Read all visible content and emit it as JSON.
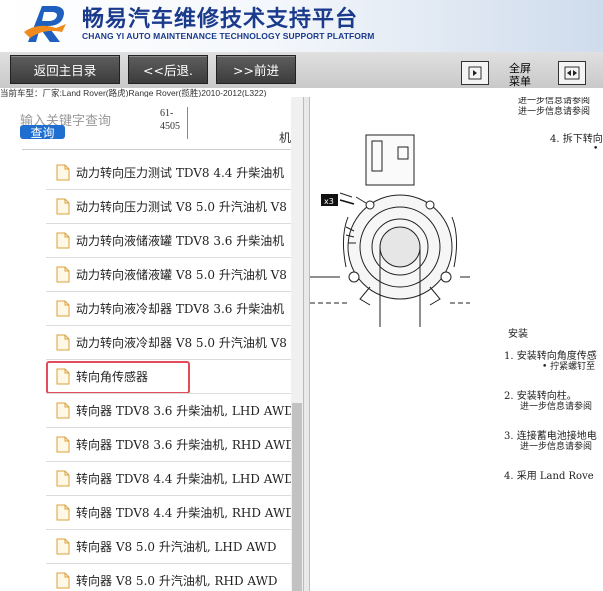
{
  "header": {
    "title_cn": "畅易汽车维修技术支持平台",
    "title_en": "CHANG YI AUTO MAINTENANCE TECHNOLOGY SUPPORT PLATFORM"
  },
  "nav": {
    "home": "返回主目录",
    "back": "<<后退.",
    "forward": ">>前进",
    "fullscreen_line1": "全屏",
    "fullscreen_line2": "菜单"
  },
  "model_line": "当前车型：厂家:Land Rover(路虎)Range Rover(揽胜)2010-2012(L322)",
  "search": {
    "placeholder": "输入关键字查询",
    "button": "查询",
    "part_code_line1": "61-",
    "part_code_line2": "4505",
    "trailing_char": "机"
  },
  "tree": {
    "items": [
      {
        "label": "动力转向压力测试 TDV8 4.4 升柴油机"
      },
      {
        "label": "动力转向压力测试 V8 5.0 升汽油机 V8"
      },
      {
        "label": "动力转向液储液罐 TDV8 3.6 升柴油机"
      },
      {
        "label": "动力转向液储液罐 V8 5.0 升汽油机 V8"
      },
      {
        "label": "动力转向液冷却器 TDV8 3.6 升柴油机"
      },
      {
        "label": "动力转向液冷却器 V8 5.0 升汽油机 V8"
      },
      {
        "label": "转向角传感器"
      },
      {
        "label": "转向器 TDV8 3.6 升柴油机, LHD AWD"
      },
      {
        "label": "转向器 TDV8 3.6 升柴油机, RHD AWD"
      },
      {
        "label": "转向器 TDV8 4.4 升柴油机, LHD AWD"
      },
      {
        "label": "转向器 TDV8 4.4 升柴油机, RHD AWD"
      },
      {
        "label": "转向器 V8 5.0 升汽油机, LHD AWD"
      },
      {
        "label": "转向器 V8 5.0 升汽油机, RHD AWD"
      }
    ],
    "selected_index": 6
  },
  "content": {
    "top_line1": "进一步信息请参阅",
    "step4": "4.  拆下转向",
    "bullet": "•",
    "callout": "x3",
    "install_heading": "安装",
    "install_1": "1.  安装转向角度传感",
    "install_1_sub": "•  拧紧螺钉至",
    "install_2": "2.  安装转向柱。",
    "install_2_sub": "进一步信息请参阅",
    "install_3": "3.  连接蓄电池接地电",
    "install_3_sub": "进一步信息请参阅",
    "install_4": "4.  采用 Land Rove"
  },
  "colors": {
    "brand_blue": "#1a3a8c",
    "highlight_red": "#e34b5a",
    "query_blue": "#1f6fd0"
  }
}
